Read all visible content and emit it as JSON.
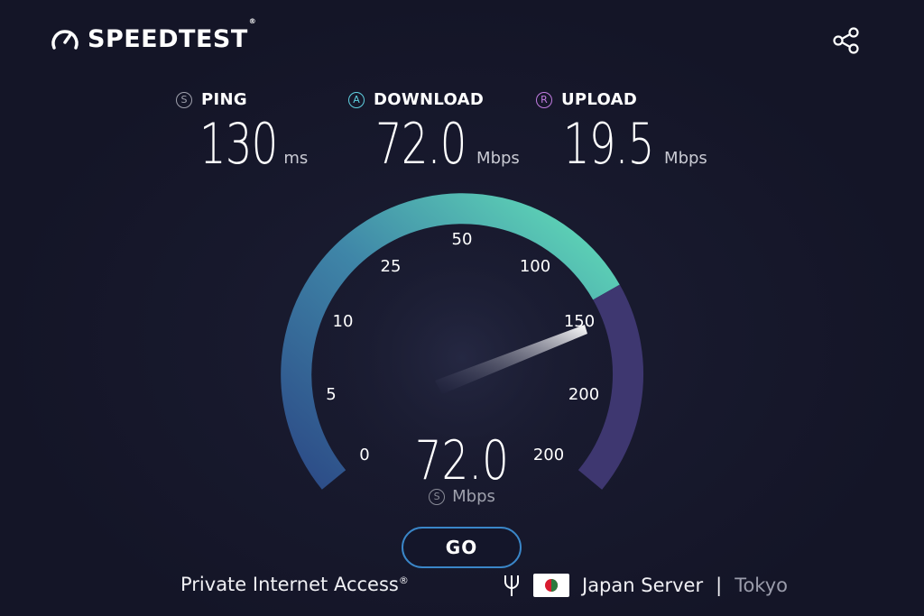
{
  "app": {
    "logo_text": "SPEEDTEST",
    "logo_mark": "®",
    "share_icon": "share-icon"
  },
  "metrics": {
    "ping": {
      "badge": "S",
      "label": "PING",
      "value": "130",
      "unit": "ms"
    },
    "download": {
      "badge": "A",
      "label": "DOWNLOAD",
      "value": "72.0",
      "unit": "Mbps"
    },
    "upload": {
      "badge": "R",
      "label": "UPLOAD",
      "value": "19.5",
      "unit": "Mbps"
    }
  },
  "gauge": {
    "ticks": [
      "0",
      "5",
      "10",
      "25",
      "50",
      "100",
      "150",
      "200",
      "200"
    ],
    "current_value": "72.0",
    "unit": "Mbps",
    "unit_badge": "S"
  },
  "go_button": {
    "label": "GO"
  },
  "provider": {
    "name": "Private Internet Access",
    "mark": "®"
  },
  "server": {
    "name": "Japan Server",
    "separator": "|",
    "city": "Tokyo"
  },
  "colors": {
    "background": "#151628",
    "arc_teal": "#5fd9b8",
    "arc_blue": "#3a5f9e",
    "arc_purple": "#3e3770",
    "accent_blue": "#3a86c8"
  }
}
